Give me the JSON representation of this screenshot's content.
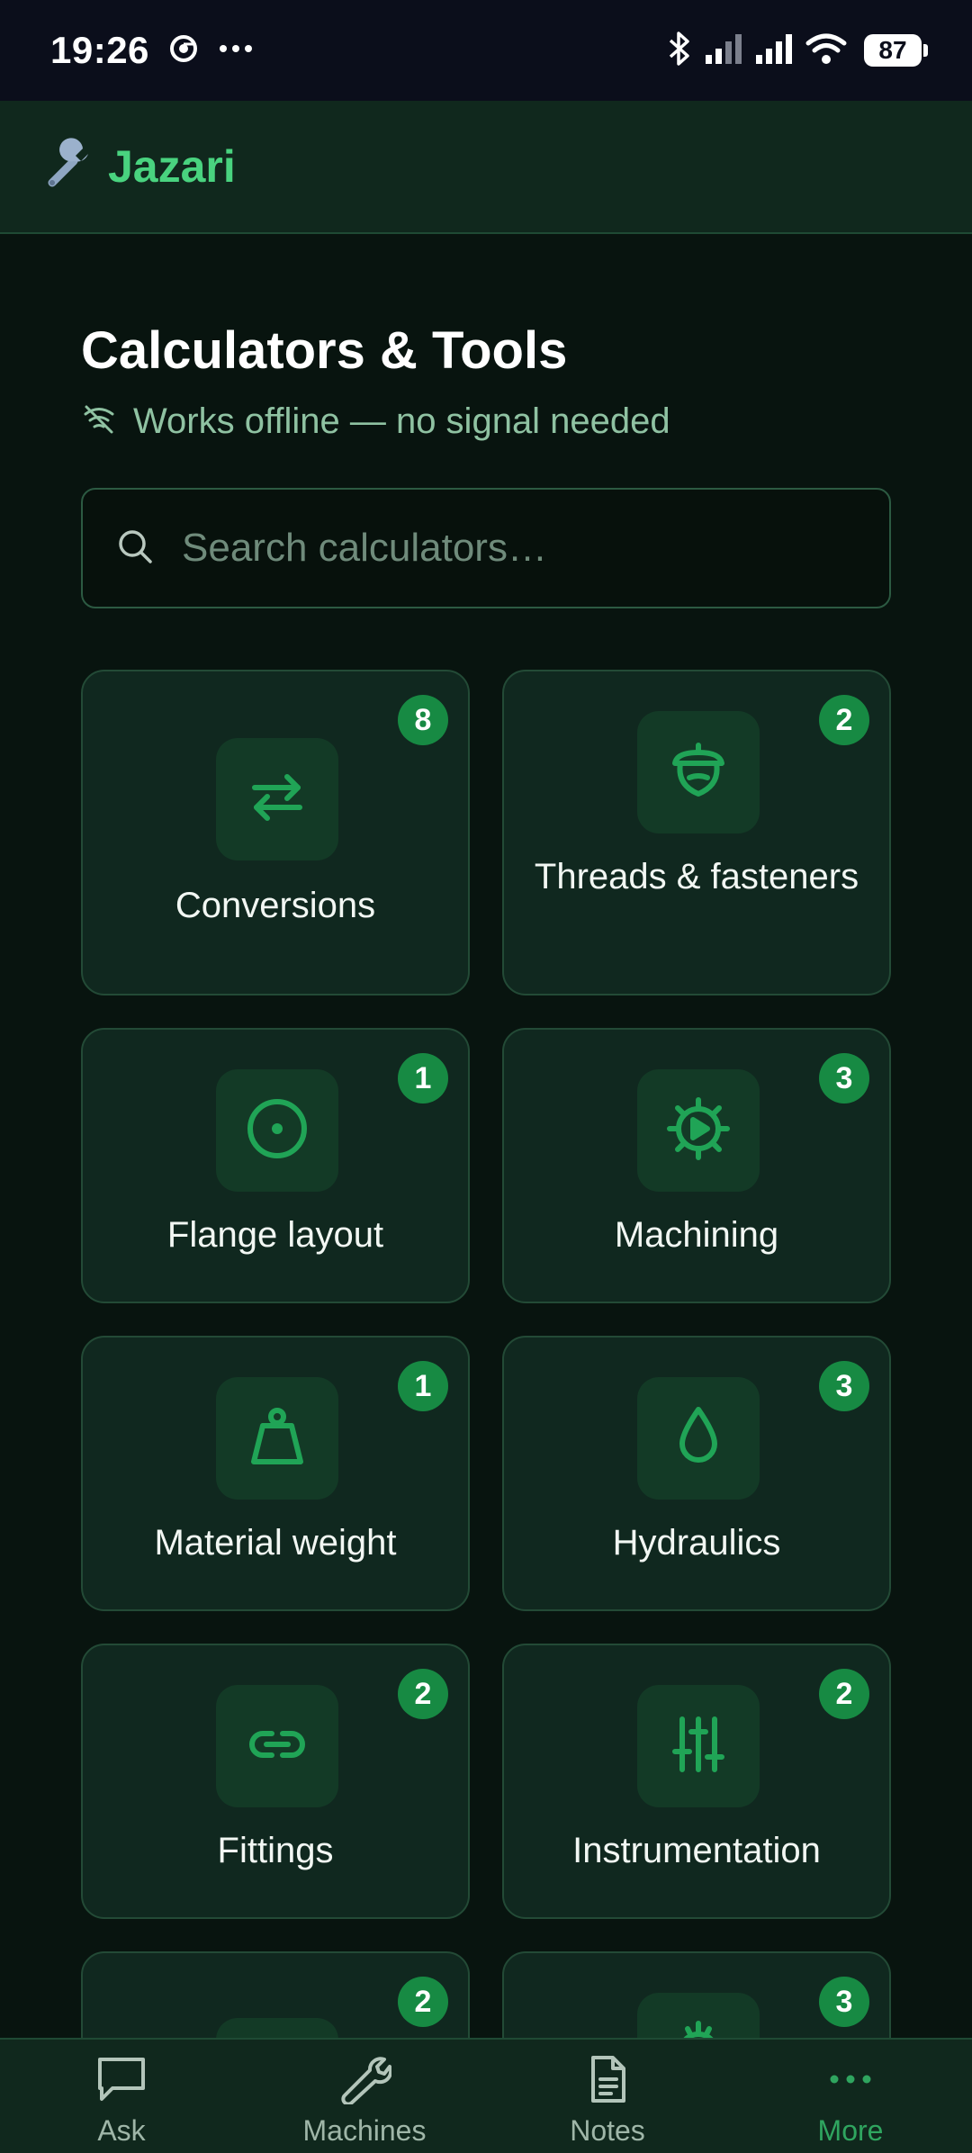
{
  "status_bar": {
    "time": "19:26",
    "battery": "87",
    "icons": [
      "chrome-icon",
      "more-dots-icon",
      "bluetooth-icon",
      "signal-icon",
      "signal-icon",
      "wifi-icon",
      "battery-icon"
    ]
  },
  "header": {
    "app_icon": "wrench-icon",
    "app_name": "Jazari"
  },
  "main": {
    "title": "Calculators & Tools",
    "offline_icon": "wifi-off-icon",
    "offline_text": "Works offline — no signal needed",
    "search": {
      "placeholder": "Search calculators…",
      "value": ""
    }
  },
  "tiles": [
    {
      "label": "Conversions",
      "count": "8",
      "icon": "arrows-swap-icon"
    },
    {
      "label": "Threads & fasteners",
      "count": "2",
      "icon": "nut-icon"
    },
    {
      "label": "Flange layout",
      "count": "1",
      "icon": "circle-dot-icon"
    },
    {
      "label": "Machining",
      "count": "3",
      "icon": "gear-play-icon"
    },
    {
      "label": "Material weight",
      "count": "1",
      "icon": "weight-icon"
    },
    {
      "label": "Hydraulics",
      "count": "3",
      "icon": "drop-icon"
    },
    {
      "label": "Fittings",
      "count": "2",
      "icon": "link-icon"
    },
    {
      "label": "Instrumentation",
      "count": "2",
      "icon": "sliders-icon"
    },
    {
      "label": "",
      "count": "2",
      "icon": ""
    },
    {
      "label": "",
      "count": "3",
      "icon": ""
    }
  ],
  "bottom_nav": {
    "items": [
      {
        "label": "Ask",
        "icon": "chat-icon"
      },
      {
        "label": "Machines",
        "icon": "wrench-icon"
      },
      {
        "label": "Notes",
        "icon": "document-icon"
      },
      {
        "label": "More",
        "icon": "more-dots-icon"
      }
    ],
    "active": "More"
  },
  "colors": {
    "accent": "#49d37f",
    "badge": "#178a43",
    "background": "#08140f",
    "tile": "#10281f",
    "status_bar": "#0b0e1b"
  }
}
